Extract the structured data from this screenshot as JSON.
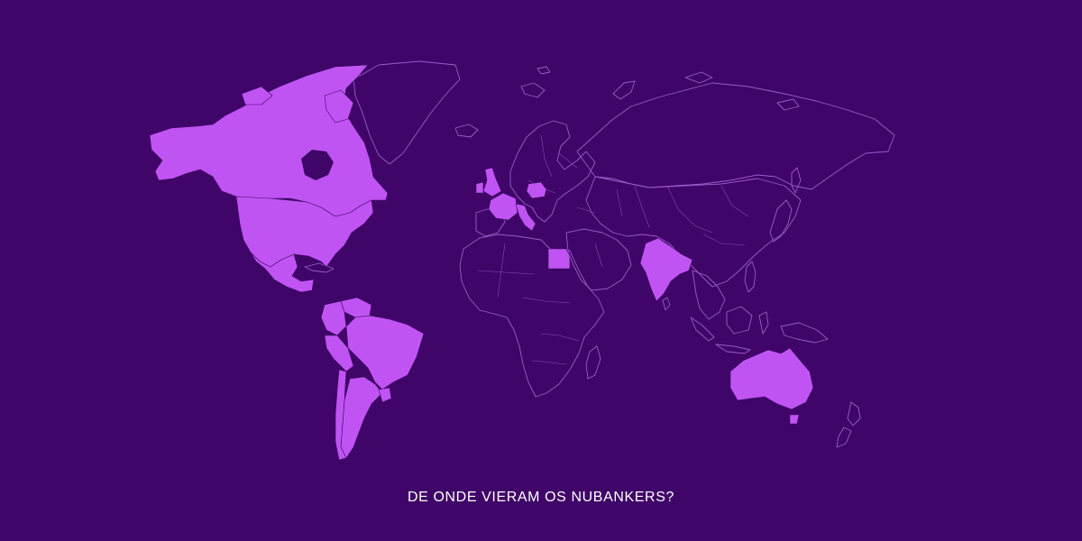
{
  "caption": "DE ONDE VIERAM OS NUBANKERS?",
  "colors": {
    "background": "#3f0568",
    "highlight": "#c054f2",
    "outline": "#9d5bc9"
  },
  "highlighted_countries": [
    "Canada",
    "United States",
    "Mexico",
    "Colombia",
    "Venezuela",
    "Peru",
    "Brazil",
    "Argentina",
    "Chile",
    "Uruguay",
    "United Kingdom",
    "France",
    "Italy",
    "Poland",
    "Egypt",
    "India",
    "Australia"
  ]
}
